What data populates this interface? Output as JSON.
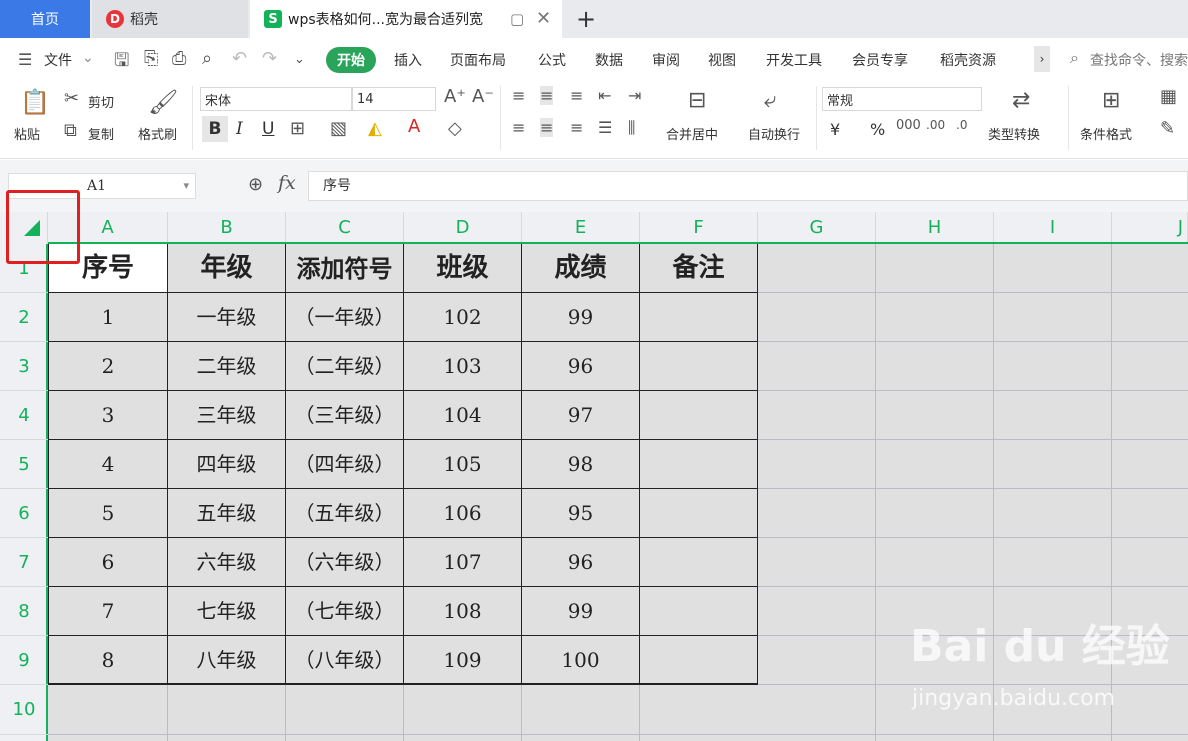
{
  "tabs": {
    "home": "首页",
    "daoke": "稻壳",
    "doc_title": "wps表格如何...宽为最合适列宽",
    "new_tab": "+"
  },
  "menu": {
    "file": "文件",
    "start": "开始",
    "insert": "插入",
    "layout": "页面布局",
    "formula": "公式",
    "data": "数据",
    "review": "审阅",
    "view": "视图",
    "dev": "开发工具",
    "member": "会员专享",
    "daoke_res": "稻壳资源",
    "search": "查找命令、搜索"
  },
  "ribbon": {
    "paste": "粘贴",
    "cut": "剪切",
    "copy": "复制",
    "format_painter": "格式刷",
    "font_name": "宋体",
    "font_size": "14",
    "bold": "B",
    "italic": "I",
    "underline": "U",
    "merge_center": "合并居中",
    "wrap": "自动换行",
    "number_format": "常规",
    "type_convert": "类型转换",
    "cond_format": "条件格式",
    "currency": "¥",
    "percent": "%"
  },
  "formula_bar": {
    "cell_ref": "A1",
    "fx": "fx",
    "content": "序号"
  },
  "columns": [
    "A",
    "B",
    "C",
    "D",
    "E",
    "F",
    "G",
    "H",
    "I",
    "J"
  ],
  "rows": [
    "1",
    "2",
    "3",
    "4",
    "5",
    "6",
    "7",
    "8",
    "9",
    "10"
  ],
  "table": {
    "headers": [
      "序号",
      "年级",
      "添加符号",
      "班级",
      "成绩",
      "备注"
    ],
    "data": [
      [
        "1",
        "一年级",
        "（一年级）",
        "102",
        "99",
        ""
      ],
      [
        "2",
        "二年级",
        "（二年级）",
        "103",
        "96",
        ""
      ],
      [
        "3",
        "三年级",
        "（三年级）",
        "104",
        "97",
        ""
      ],
      [
        "4",
        "四年级",
        "（四年级）",
        "105",
        "98",
        ""
      ],
      [
        "5",
        "五年级",
        "（五年级）",
        "106",
        "95",
        ""
      ],
      [
        "6",
        "六年级",
        "（六年级）",
        "107",
        "96",
        ""
      ],
      [
        "7",
        "七年级",
        "（七年级）",
        "108",
        "99",
        ""
      ],
      [
        "8",
        "八年级",
        "（八年级）",
        "109",
        "100",
        ""
      ]
    ]
  },
  "watermark": {
    "brand": "Bai du 经验",
    "url": "jingyan.baidu.com"
  },
  "colors": {
    "accent_green": "#13b25a",
    "tab_home_blue": "#3b79e6",
    "highlight_red": "#e02020"
  }
}
